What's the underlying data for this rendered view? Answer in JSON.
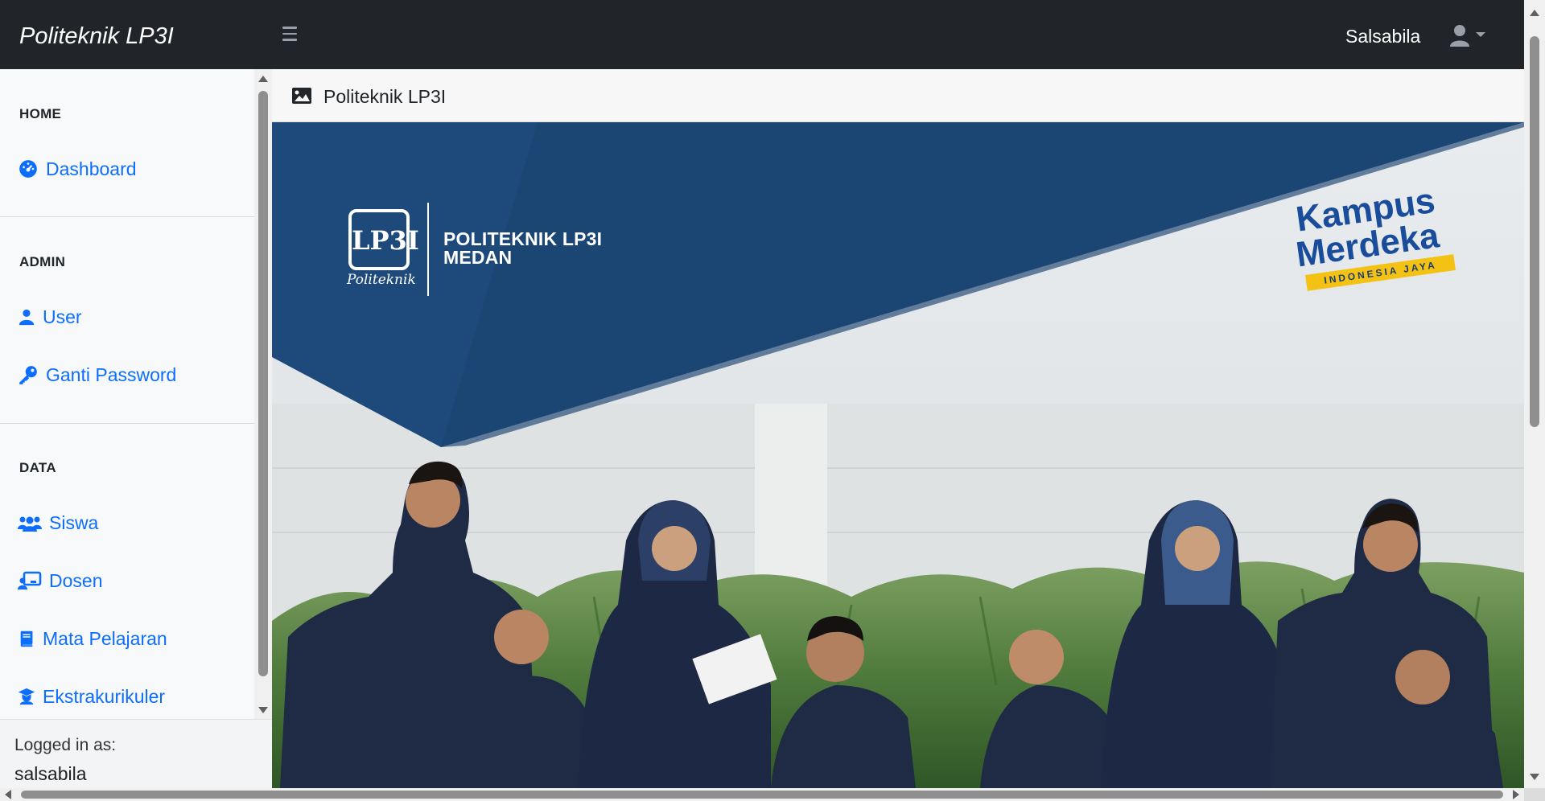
{
  "navbar": {
    "brand": "Politeknik LP3I",
    "toggle_icon": "hamburger-icon",
    "username": "Salsabila",
    "user_icon": "user-icon",
    "dropdown_icon": "caret-down-icon"
  },
  "sidebar": {
    "sections": [
      {
        "heading": "HOME"
      },
      {
        "heading": "ADMIN"
      },
      {
        "heading": "DATA"
      }
    ],
    "items": [
      {
        "label": "Dashboard",
        "icon": "dashboard-gauge-icon"
      },
      {
        "label": "User",
        "icon": "user-icon"
      },
      {
        "label": "Ganti Password",
        "icon": "key-icon"
      },
      {
        "label": "Siswa",
        "icon": "users-icon"
      },
      {
        "label": "Dosen",
        "icon": "chalkboard-teacher-icon"
      },
      {
        "label": "Mata Pelajaran",
        "icon": "book-icon"
      },
      {
        "label": "Ekstrakurikuler",
        "icon": "graduate-icon"
      }
    ],
    "footer": {
      "label": "Logged in as:",
      "user": "salsabila"
    }
  },
  "main": {
    "card_title": "Politeknik LP3I",
    "card_icon": "image-icon",
    "banner": {
      "logo_mark": "LP3I",
      "logo_script": "Politeknik",
      "logo_text_line1": "POLITEKNIK LP3I",
      "logo_text_line2": "MEDAN",
      "partner_line1": "Kampus",
      "partner_line2": "Merdeka",
      "partner_tagline": "INDONESIA JAYA"
    }
  },
  "colors": {
    "navbar_bg": "#212529",
    "sidebar_bg": "#f8f9fa",
    "link": "#0d6efd",
    "banner_navy": "#1d4a7a",
    "kampus_merdeka_blue": "#1a4c9c",
    "ribbon_yellow": "#f3c215"
  }
}
